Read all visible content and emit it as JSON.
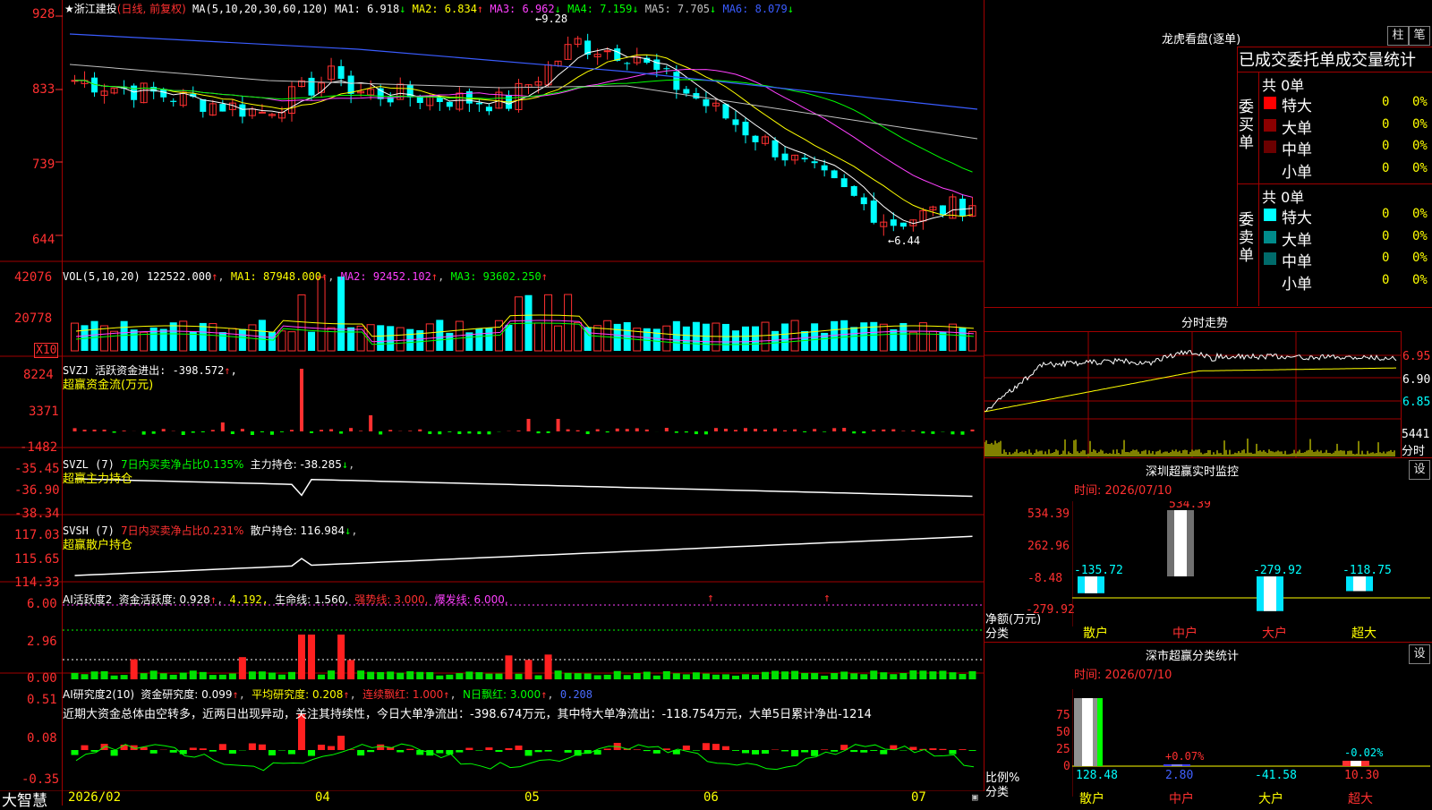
{
  "stock": {
    "name": "浙江建投",
    "period_mode": "(日线, 前复权)",
    "ma_prefix": "MA(5,10,20,30,60,120)",
    "ma": [
      {
        "label": "MA1: 6.918",
        "arrow": "↓",
        "color": "#ffffff"
      },
      {
        "label": "MA2: 6.834",
        "arrow": "↑",
        "color": "#ffff00"
      },
      {
        "label": "MA3: 6.962",
        "arrow": "↓",
        "color": "#ff40ff"
      },
      {
        "label": "MA4: 7.159",
        "arrow": "↓",
        "color": "#00ff00"
      },
      {
        "label": "MA5: 7.705",
        "arrow": "↓",
        "color": "#c0c0c0"
      },
      {
        "label": "MA6: 8.079",
        "arrow": "↓",
        "color": "#3a5cff"
      }
    ],
    "price_axis": [
      "928",
      "833",
      "739",
      "644"
    ],
    "high_marker": "9.28",
    "low_marker": "6.44"
  },
  "volume": {
    "prefix": "VOL(5,10,20)",
    "value": "122522.000",
    "ma": [
      {
        "label": "MA1: 87948.000",
        "color": "#ffff00"
      },
      {
        "label": "MA2: 92452.102",
        "color": "#ff40ff"
      },
      {
        "label": "MA3: 93602.250",
        "color": "#00ff00"
      }
    ],
    "axis": [
      "42076",
      "20778"
    ],
    "unit": "X10"
  },
  "svzj": {
    "line1": "SVZJ  活跃资金进出: -398.572",
    "line2": "超赢资金流(万元)",
    "axis": [
      "8224",
      "3371",
      "-1482"
    ]
  },
  "svzl": {
    "prefix": "SVZL (7)",
    "ratio": "7日内买卖净占比0.135%",
    "hold": "主力持仓: -38.285",
    "line2": "超赢主力持仓",
    "axis": [
      "-35.45",
      "-36.90",
      "-38.34"
    ]
  },
  "svsh": {
    "prefix": "SVSH (7)",
    "ratio": "7日内买卖净占比0.231%",
    "hold": "散户持仓: 116.984",
    "line2": "超赢散户持仓",
    "axis": [
      "117.03",
      "115.65",
      "114.33"
    ]
  },
  "ai_active": {
    "title": "AI活跃度2",
    "fund": "资金活跃度: 0.928",
    "v2": "4.192,",
    "life": "生命线: 1.560,",
    "strong": "强势线: 3.000,",
    "burst": "爆发线: 6.000,",
    "axis": [
      "6.00",
      "2.96",
      "0.00"
    ]
  },
  "ai_research": {
    "title": "AI研究度2(10)",
    "fund": "资金研究度: 0.099",
    "avg": "平均研究度: 0.208",
    "streak": "连续飘红: 1.000",
    "nday": "N日飘红: 3.000",
    "extra": "0.208",
    "comment": "近期大资金总体由空转多，近两日出现异动，关注其持续性，今日大单净流出：-398.674万元，其中特大单净流出：-118.754万元，大单5日累计净出-1214",
    "axis": [
      "0.51",
      "0.08",
      "-0.35"
    ]
  },
  "date_axis": [
    "2026/02",
    "04",
    "05",
    "06",
    "07"
  ],
  "brand": "大智慧",
  "dragon_tiger": {
    "title": "龙虎看盘(逐单)",
    "btn_bar": "柱",
    "btn_stroke": "笔",
    "subtitle": "已成交委托单成交量统计",
    "buy_label": "委买单",
    "sell_label": "委卖单",
    "buy_total": "共 0单",
    "sell_total": "共 0单",
    "buy_rows": [
      {
        "name": "特大",
        "count": "0",
        "pct": "0%",
        "color": "#ff0000"
      },
      {
        "name": "大单",
        "count": "0",
        "pct": "0%",
        "color": "#8b0000"
      },
      {
        "name": "中单",
        "count": "0",
        "pct": "0%",
        "color": "#6b0000"
      },
      {
        "name": "小单",
        "count": "0",
        "pct": "0%",
        "color": "#000000"
      }
    ],
    "sell_rows": [
      {
        "name": "特大",
        "count": "0",
        "pct": "0%",
        "color": "#00ffff"
      },
      {
        "name": "大单",
        "count": "0",
        "pct": "0%",
        "color": "#008b8b"
      },
      {
        "name": "中单",
        "count": "0",
        "pct": "0%",
        "color": "#006b6b"
      },
      {
        "name": "小单",
        "count": "0",
        "pct": "0%",
        "color": "#000000"
      }
    ]
  },
  "intraday": {
    "title": "分时走势",
    "axis": [
      "6.95",
      "6.90",
      "6.85"
    ],
    "vol": "5441",
    "vol_label": "分时"
  },
  "monitor": {
    "title": "深圳超赢实时监控",
    "btn": "设",
    "time": "时间: 2026/07/10",
    "axis": [
      "534.39",
      "262.96",
      "-8.48",
      "-279.92"
    ],
    "net_label": "净额(万元)",
    "cat_label": "分类",
    "categories": [
      "散户",
      "中户",
      "大户",
      "超大"
    ],
    "values": [
      -135.72,
      534.39,
      -279.92,
      -118.75
    ],
    "value_labels": [
      "-135.72",
      "534.39",
      "-279.92",
      "-118.75"
    ]
  },
  "classify": {
    "title": "深市超赢分类统计",
    "btn": "设",
    "time": "时间: 2026/07/10",
    "axis": [
      "75",
      "50",
      "25",
      "0"
    ],
    "ratio_label": "比例%",
    "cat_label": "分类",
    "categories": [
      "散户",
      "中户",
      "大户",
      "超大"
    ],
    "top_labels": [
      "",
      "+0.07%",
      "",
      "-0.02%"
    ],
    "bottom_labels": [
      "128.48",
      "2.80",
      "-41.58",
      "10.30"
    ]
  },
  "colors": {
    "up": "#ff3030",
    "down": "#00ffff",
    "grid": "#a00000",
    "ma_white": "#ffffff",
    "ma_yellow": "#ffff00",
    "ma_magenta": "#ff40ff",
    "ma_green": "#00ff00",
    "ma_gray": "#c0c0c0",
    "ma_blue": "#3a5cff"
  }
}
